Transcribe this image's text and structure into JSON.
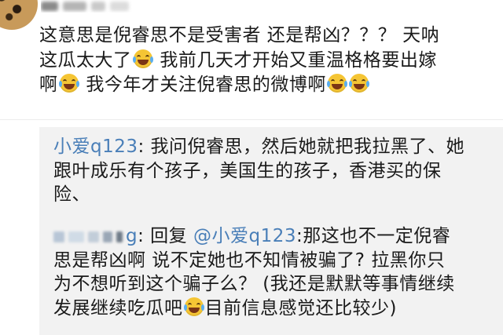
{
  "comment": {
    "lines": [
      "这意思是倪睿思不是受害者 还是帮凶？？？ 天呐",
      [
        "这瓜太大了",
        "我前几天才开始又重温格格要出嫁"
      ],
      [
        "啊",
        "我今年才关注倪睿思的微博啊"
      ]
    ]
  },
  "reply1": {
    "user": "小爱q123",
    "line1_rest": ": 我问倪睿思，然后她就把我拉黑了、她",
    "line2": "跟叶成乐有个孩子，美国生的孩子，香港买的保",
    "line3": "险、"
  },
  "reply2": {
    "tail_char": "g",
    "reply_word": ": 回复 ",
    "mention": "@小爱q123",
    "line1_rest": ":那这也不一定倪睿",
    "line2": "思是帮凶啊 说不定她也不知情被骗了? 拉黑你只",
    "line3": "为不想听到这个骗子么？ (我还是默默等事情继续",
    "line4_before_emoji": "发展继续吃瓜吧",
    "line4_after_emoji": "目前信息感觉还比较少)"
  },
  "icons": {
    "emoji": "laughing-tears-emoji"
  },
  "colors": {
    "text": "#1a1a1a",
    "link": "#4a7fb8",
    "reply_bg": "#f2f2f2",
    "emoji": "#f5c534"
  }
}
